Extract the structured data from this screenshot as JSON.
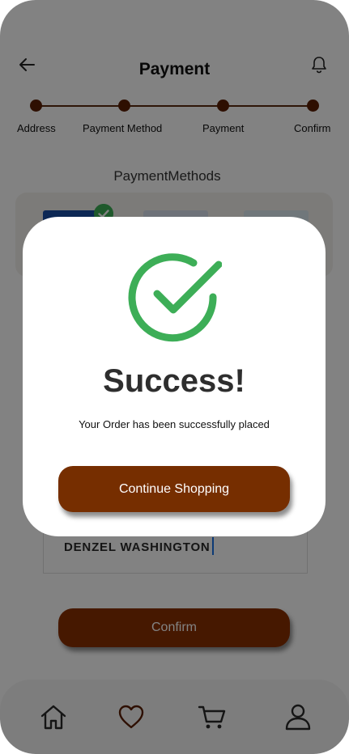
{
  "header": {
    "title": "Payment",
    "back_icon": "arrow-left-icon",
    "notification_icon": "bell-icon"
  },
  "stepper": {
    "steps": [
      {
        "label": "Address"
      },
      {
        "label": "Payment Method"
      },
      {
        "label": "Payment"
      },
      {
        "label": "Confirm"
      }
    ]
  },
  "payment_methods": {
    "title": "PaymentMethods",
    "selected_icon": "check-badge-icon"
  },
  "card_holder": {
    "value": "DENZEL WASHINGTON"
  },
  "confirm_label": "Confirm",
  "bottom_nav": {
    "items": [
      {
        "icon": "home-icon"
      },
      {
        "icon": "heart-icon"
      },
      {
        "icon": "cart-icon"
      },
      {
        "icon": "user-icon"
      }
    ]
  },
  "modal": {
    "icon": "success-check-icon",
    "title": "Success!",
    "message": "Your Order has been successfully placed",
    "button_label": "Continue Shopping"
  },
  "colors": {
    "primary_brown": "#762e00",
    "stepper_brown": "#5a1f03",
    "success_green": "#3dae57",
    "overlay": "rgba(0,0,0,0.49)"
  }
}
